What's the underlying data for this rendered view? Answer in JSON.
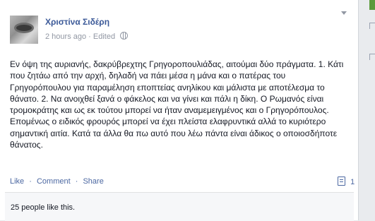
{
  "post": {
    "author": "Χριστίνα Σιδέρη",
    "timestamp": "2 hours ago",
    "edited": "Edited",
    "privacy_icon": "globe-icon",
    "body": "Εν όψη της αυριανής, δακρύβρεχτης Γρηγοροπουλιάδας, αιτούμαι δύο πράγματα. 1. Κάτι που ζητάω από την αρχή, δηλαδή να πάει μέσα η μάνα και ο πατέρας του Γρηγορόπουλου για παραμέληση εποπτείας ανηλίκου και μάλιστα με αποτέλεσμα το θάνατο. 2. Να ανοιχθεί ξανά ο φάκελος και να γίνει και πάλι η δίκη. Ο Ρωμανός είναι τρομοκράτης και ως εκ τούτου μπορεί να ήταν αναμεμειγμένος και ο Γρηγορόπουλος. Επομένως ο ειδικός φρουρός μπορεί να έχει πλείστα ελαφρυντικά αλλά το κυριότερο σημαντική αιτία. Κατά τα άλλα θα πω αυτό που λέω πάντα είναι άδικος ο οποιοσδήποτε θάνατος."
  },
  "actions": {
    "like": "Like",
    "comment": "Comment",
    "share": "Share",
    "separator": "·",
    "comment_count": "1"
  },
  "likes": {
    "text": "25 people like this."
  },
  "colors": {
    "link": "#3b5998",
    "action": "#4b67a1",
    "meta": "#9197a3"
  }
}
